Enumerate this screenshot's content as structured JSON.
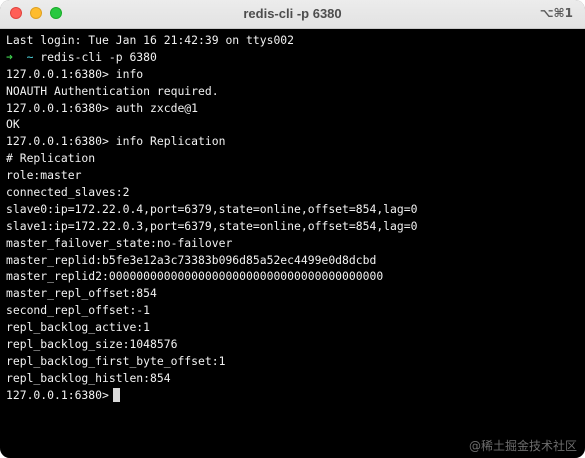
{
  "window": {
    "title": "redis-cli -p 6380",
    "shortcut": "⌥⌘1"
  },
  "terminal": {
    "lines": [
      "Last login: Tue Jan 16 21:42:39 on ttys002",
      "redis-cli -p 6380",
      "127.0.0.1:6380> info",
      "NOAUTH Authentication required.",
      "127.0.0.1:6380> auth zxcde@1",
      "OK",
      "127.0.0.1:6380> info Replication",
      "# Replication",
      "role:master",
      "connected_slaves:2",
      "slave0:ip=172.22.0.4,port=6379,state=online,offset=854,lag=0",
      "slave1:ip=172.22.0.3,port=6379,state=online,offset=854,lag=0",
      "master_failover_state:no-failover",
      "master_replid:b5fe3e12a3c73383b096d85a52ec4499e0d8dcbd",
      "master_replid2:0000000000000000000000000000000000000000",
      "master_repl_offset:854",
      "second_repl_offset:-1",
      "repl_backlog_active:1",
      "repl_backlog_size:1048576",
      "repl_backlog_first_byte_offset:1",
      "repl_backlog_histlen:854",
      "127.0.0.1:6380>"
    ],
    "prompt_arrow": "➜",
    "prompt_dir": "~",
    "colors": {
      "background": "#000000",
      "text": "#f2f2f2",
      "arrow": "#3fd14e",
      "dir": "#4fd8e0"
    }
  },
  "watermark": "@稀土掘金技术社区",
  "icons": {
    "close": "close-icon",
    "minimize": "minimize-icon",
    "maximize": "maximize-icon"
  }
}
